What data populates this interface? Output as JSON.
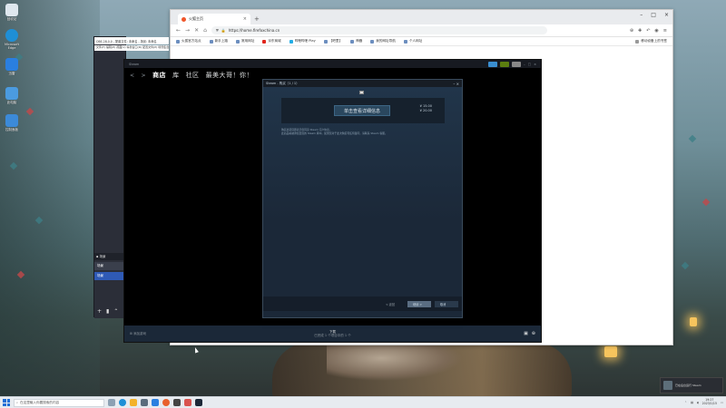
{
  "desktop": {
    "icons": [
      {
        "label": "回收站",
        "color": "#dfe7ee"
      },
      {
        "label": "Microsoft Edge",
        "color": "#1f8fd6"
      },
      {
        "label": "迅雷",
        "color": "#2a7fe0"
      },
      {
        "label": "此电脑",
        "color": "#4b9be0"
      },
      {
        "label": "控制面板",
        "color": "#3c8ad8"
      }
    ]
  },
  "browser": {
    "tab_title": "火狐主页",
    "url": "https://home.firefoxchina.cn",
    "bookmarks": [
      "火狐官方站点",
      "新手上路",
      "常用网址",
      "京东商城",
      "哔哩哔哩 Play",
      "【吧里】",
      "神器",
      "我的网址导航",
      "个人网址"
    ],
    "bookmark_right": "移动设备上的书签"
  },
  "obs": {
    "title": "OBS 28.0.0 - 配置文件: 未命名 - 场景: 未命名",
    "menu": "文件(F)  编辑(E)  视图(V)  停靠窗口(D)  配置文件(P)  场景集合(S)",
    "scenes_header": "场景",
    "scenes": [
      "场景",
      "场景"
    ]
  },
  "steam": {
    "nav": {
      "store": "商店",
      "library": "库",
      "community": "社区",
      "user": "最美大哥！你！"
    },
    "bottom_left": "添加游戏",
    "download_title": "下载",
    "download_status": "已完成 1 个项目中的 1 个",
    "dialog": {
      "title": "Steam - 购买（1 / 1）",
      "banner_button": "单击查看详细信息",
      "price_main": "¥ 15.00",
      "price_sub": "¥ 20.00",
      "desc_1": "购买此项目即表示您同意 Steam 订户协议。",
      "desc_2": "此商品将被添加至您的 Steam 库中。如果您对于此次购买有任何疑问，请联系 Steam 客服。",
      "btn_back": "< 返回",
      "btn_next": "继续 >",
      "btn_cancel": "取消"
    }
  },
  "taskbar": {
    "search_placeholder": "在这里输入你要搜索的内容",
    "time": "19:27",
    "date": "2023/1/15"
  },
  "toast": {
    "text": "已在后台运行 Steam"
  }
}
